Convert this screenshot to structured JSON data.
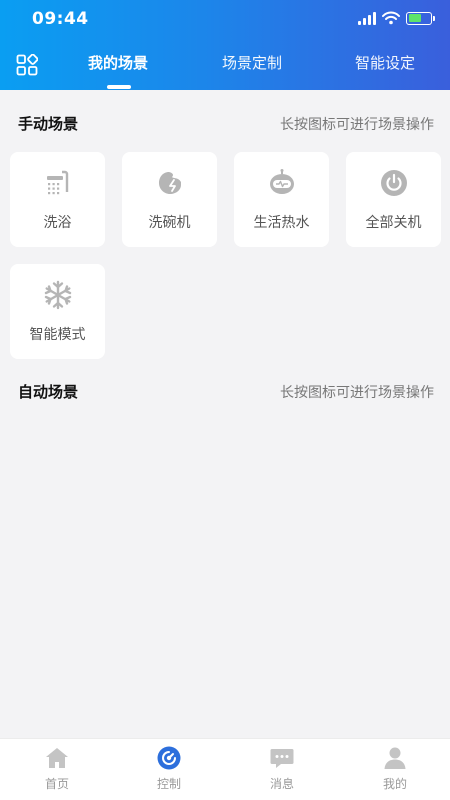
{
  "status_bar": {
    "time": "09:44"
  },
  "tabs": [
    {
      "label": "我的场景",
      "active": true
    },
    {
      "label": "场景定制",
      "active": false
    },
    {
      "label": "智能设定",
      "active": false
    }
  ],
  "manual": {
    "title": "手动场景",
    "hint": "长按图标可进行场景操作",
    "cards": [
      {
        "label": "洗浴",
        "icon": "shower-icon"
      },
      {
        "label": "洗碗机",
        "icon": "dishwasher-icon"
      },
      {
        "label": "生活热水",
        "icon": "robot-hotwater-icon"
      },
      {
        "label": "全部关机",
        "icon": "power-icon"
      },
      {
        "label": "智能模式",
        "icon": "snowflake-icon"
      }
    ]
  },
  "auto": {
    "title": "自动场景",
    "hint": "长按图标可进行场景操作"
  },
  "bottom_nav": [
    {
      "label": "首页",
      "icon": "home-icon",
      "active": false
    },
    {
      "label": "控制",
      "icon": "control-icon",
      "active": true
    },
    {
      "label": "消息",
      "icon": "message-icon",
      "active": false
    },
    {
      "label": "我的",
      "icon": "user-icon",
      "active": false
    }
  ],
  "colors": {
    "accent": "#2d6fdc",
    "icon_gray": "#b5b5b5",
    "nav_gray": "#c4c4c4"
  }
}
